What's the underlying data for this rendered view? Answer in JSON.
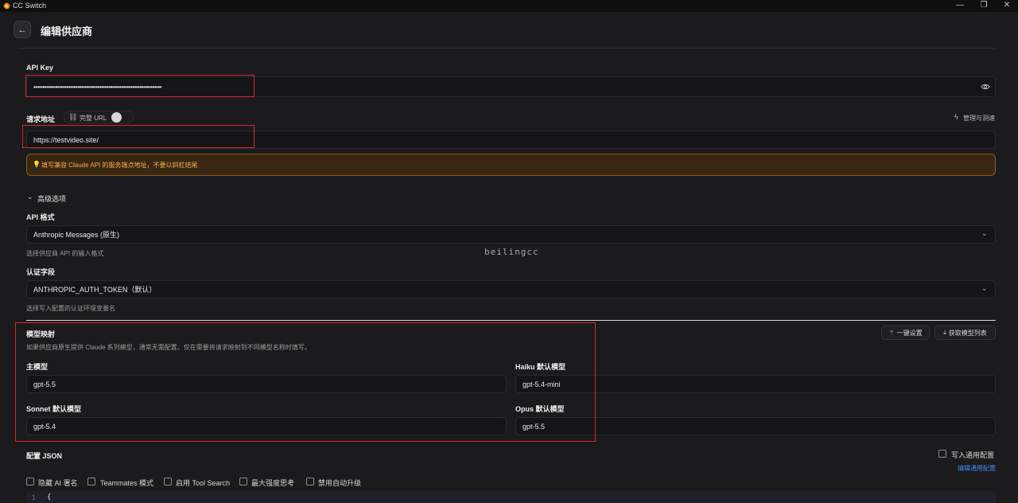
{
  "window": {
    "title": "CC Switch",
    "controls": [
      "—",
      "❐",
      "✕"
    ]
  },
  "header": {
    "back_icon": "arrow-left-icon",
    "title": "编辑供应商"
  },
  "api_key": {
    "label": "API Key",
    "value": "••••••••••••••••••••••••••••••••••••••••••••••••••••••••••••••••••••••",
    "toggle_icon": "eye-icon"
  },
  "request_url": {
    "label": "请求地址",
    "toggle_label": "完整 URL",
    "manage_label": "管理与测速",
    "value": "https://testvideo.site/",
    "warning": "填写兼容 Claude API 的服务端点地址，不要以斜杠结尾"
  },
  "advanced": {
    "toggle_label": "高级选项",
    "api_format": {
      "label": "API 格式",
      "value": "Anthropic Messages (原生)",
      "hint": "选择供应商 API 的输入格式"
    },
    "auth_field": {
      "label": "认证字段",
      "value": "ANTHROPIC_AUTH_TOKEN（默认）",
      "hint": "选择写入配置的认证环境变量名"
    }
  },
  "watermark": "beilingcc",
  "model_mapping": {
    "label": "模型映射",
    "hint": "如果供应商原生提供 Claude 系列模型，通常无需配置。仅在需要将请求映射到不同模型名称时填写。",
    "one_click_label": "一键设置",
    "fetch_label": "获取模型列表",
    "main_model": {
      "label": "主模型",
      "value": "gpt-5.5"
    },
    "haiku_model": {
      "label": "Haiku 默认模型",
      "value": "gpt-5.4-mini"
    },
    "sonnet_model": {
      "label": "Sonnet 默认模型",
      "value": "gpt-5.4"
    },
    "opus_model": {
      "label": "Opus 默认模型",
      "value": "gpt-5.5"
    }
  },
  "config_json": {
    "label": "配置 JSON",
    "write_common_label": "写入通用配置",
    "edit_common_label": "编辑通用配置",
    "options": [
      "隐藏 AI 署名",
      "Teammates 模式",
      "启用 Tool Search",
      "最大强度思考",
      "禁用自动升级"
    ],
    "code_line_number": "1",
    "code_first_char": "{"
  },
  "colors": {
    "accent": "#3f8cf0",
    "highlight": "#d7262d",
    "warning": "#f3b14e"
  }
}
